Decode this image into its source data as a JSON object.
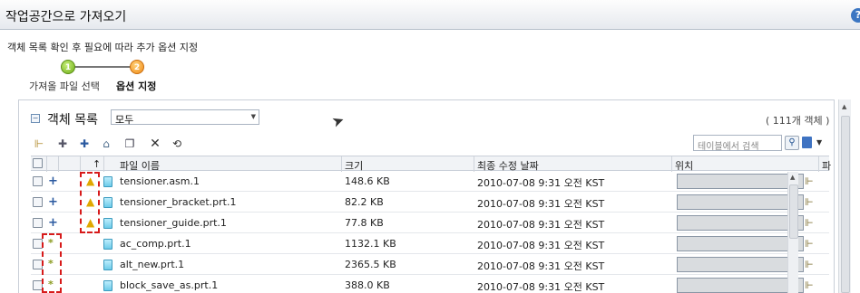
{
  "window": {
    "title": "작업공간으로 가져오기",
    "help_label": "?"
  },
  "instruction": "객체 목록 확인 후 필요에 따라 추가 옵션 지정",
  "steps": [
    {
      "number": "1",
      "label": "가져올 파일 선택"
    },
    {
      "number": "2",
      "label": "옵션 지정"
    }
  ],
  "list": {
    "collapse_symbol": "−",
    "title": "객체 목록",
    "filter_value": "모두",
    "count": "( 111개 객체 )"
  },
  "toolbar": {
    "search_placeholder": "테이블에서 검색"
  },
  "columns": {
    "sort": "↑",
    "name": "파일 이름",
    "size": "크기",
    "modified": "최종 수정 날짜",
    "location": "위치",
    "more": "파"
  },
  "rows": [
    {
      "marker": "+",
      "warning": true,
      "name": "tensioner.asm.1",
      "size": "148.6 KB",
      "modified": "2010-07-08 9:31 오전 KST"
    },
    {
      "marker": "+",
      "warning": true,
      "name": "tensioner_bracket.prt.1",
      "size": "82.2 KB",
      "modified": "2010-07-08 9:31 오전 KST"
    },
    {
      "marker": "+",
      "warning": true,
      "name": "tensioner_guide.prt.1",
      "size": "77.8 KB",
      "modified": "2010-07-08 9:31 오전 KST"
    },
    {
      "marker": "*",
      "warning": false,
      "name": "ac_comp.prt.1",
      "size": "1132.1 KB",
      "modified": "2010-07-08 9:31 오전 KST"
    },
    {
      "marker": "*",
      "warning": false,
      "name": "alt_new.prt.1",
      "size": "2365.5 KB",
      "modified": "2010-07-08 9:31 오전 KST"
    },
    {
      "marker": "*",
      "warning": false,
      "name": "block_save_as.prt.1",
      "size": "388.0 KB",
      "modified": "2010-07-08 9:31 오전 KST"
    }
  ],
  "colors": {
    "accent": "#3b76c2",
    "highlight": "#d71a1a",
    "step1": "#6fae17",
    "step2": "#f08a16"
  }
}
